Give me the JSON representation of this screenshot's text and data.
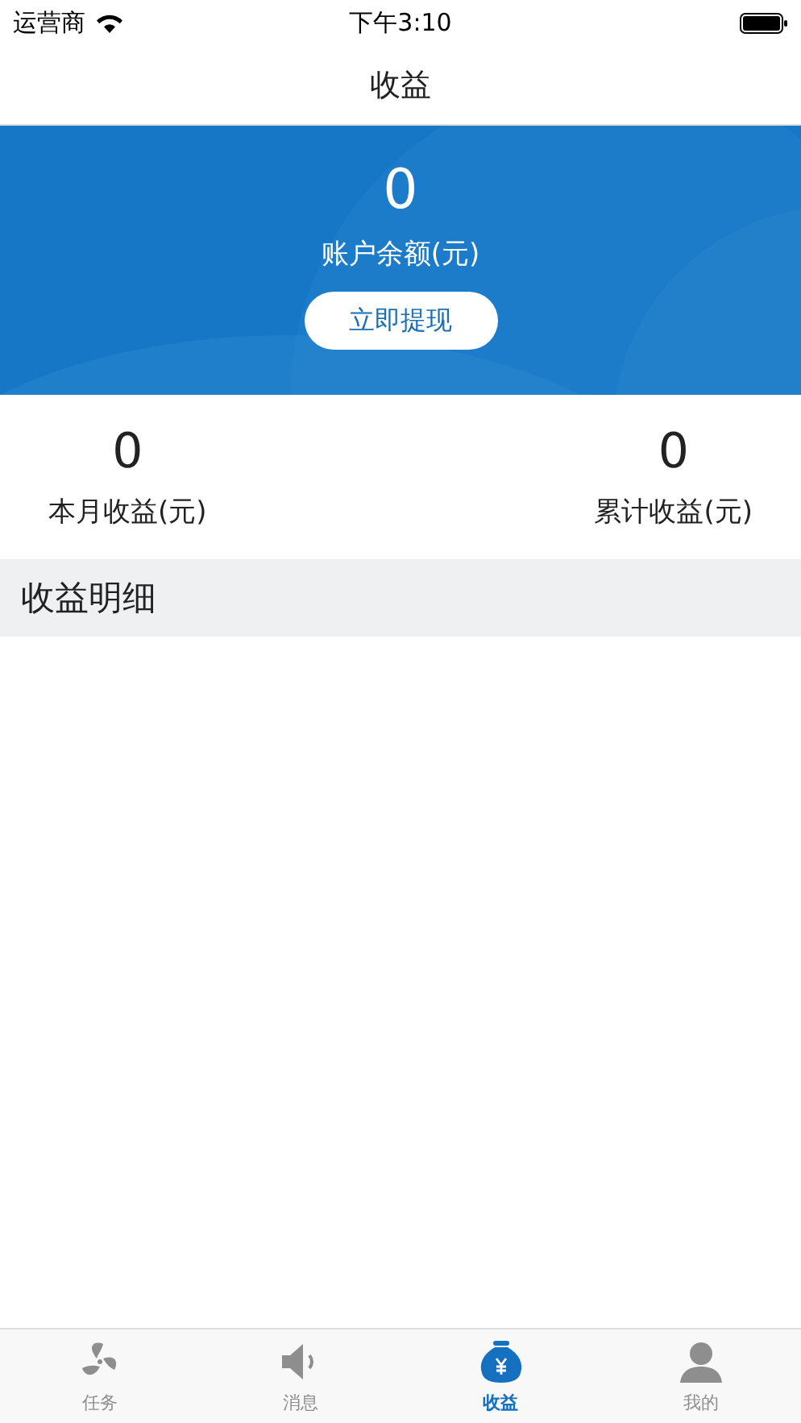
{
  "status_bar": {
    "carrier": "运营商",
    "time": "下午3:10"
  },
  "nav": {
    "title": "收益"
  },
  "balance": {
    "amount": "0",
    "label": "账户余额(元)",
    "button": "立即提现"
  },
  "stats": [
    {
      "value": "0",
      "label": "本月收益(元)"
    },
    {
      "value": "0",
      "label": "累计收益(元)"
    }
  ],
  "section": {
    "title": "收益明细"
  },
  "tabs": [
    {
      "kind": "pinwheel",
      "label": "任务",
      "selected": false
    },
    {
      "kind": "speaker",
      "label": "消息",
      "selected": false
    },
    {
      "kind": "moneybag",
      "label": "收益",
      "selected": true
    },
    {
      "kind": "person",
      "label": "我的",
      "selected": false
    }
  ]
}
